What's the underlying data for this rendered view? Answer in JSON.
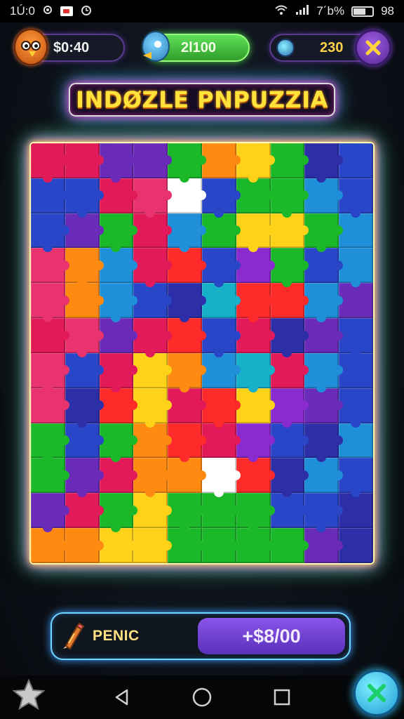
{
  "status_bar": {
    "time": "1Ú:0",
    "battery": "7´b%",
    "right_number": "98"
  },
  "hud": {
    "coins": "$0:40",
    "gems": "2l100",
    "score": "230"
  },
  "title": "INDØZLE PNPUZZIA",
  "progress": {
    "label": "PENIC",
    "value": "+$8/00",
    "progress_fraction": 0.98
  },
  "colors": {
    "accent_green": "#5fe05a",
    "accent_purple": "#8a55ea",
    "title_yellow": "#ffe23a",
    "piece_palette": [
      "#e21a5a",
      "#2a46c8",
      "#6a2bb8",
      "#1bb82a",
      "#ffd21a",
      "#ff8a12",
      "#1e8fd8",
      "#e8336f",
      "#ff2a2a",
      "#16b0c8",
      "#8a2bd0",
      "#2d2fa8"
    ]
  },
  "icons": {
    "owl_avatar": "owl-avatar-icon",
    "bird_avatar": "bird-avatar-icon",
    "score_icon": "orb-icon",
    "close": "close-icon",
    "pencil": "pencil-icon",
    "star": "star-icon",
    "nav_back": "back-triangle-icon",
    "nav_home": "home-circle-icon",
    "nav_recent": "recent-square-icon",
    "fab": "close-icon"
  }
}
